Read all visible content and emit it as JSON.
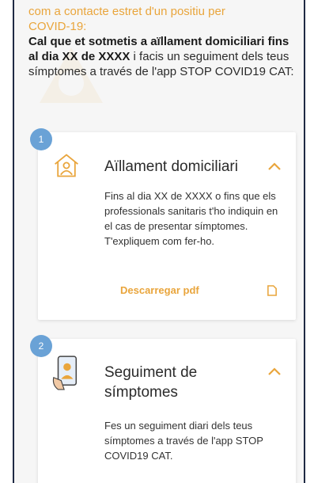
{
  "intro": {
    "orange_text": "com a contacte estret d'un positiu per COVID-19:",
    "bold_text": "Cal que et sotmetis a aïllament domiciliari fins al dia XX de XXXX",
    "rest_text": " i facis un seguiment dels teus símptomes a través de l'app STOP COVID19 CAT:"
  },
  "steps": [
    {
      "number": "1",
      "icon": "home-person-icon",
      "title": "Aïllament domiciliari",
      "body": "Fins al dia XX de XXXX o fins que els professionals sanitaris t'ho indiquin en el cas de presentar símptomes. T'expliquem com fer-ho.",
      "link": "Descarregar pdf",
      "link_icon": "document-icon"
    },
    {
      "number": "2",
      "icon": "phone-person-icon",
      "title_line1": "Seguiment de",
      "title_line2": "símptomes",
      "body": "Fes un seguiment diari dels teus símptomes a través de l'app STOP COVID19 CAT."
    }
  ],
  "colors": {
    "accent": "#e9a53c",
    "badge": "#6aa2d6",
    "background": "#f6f6f6"
  }
}
